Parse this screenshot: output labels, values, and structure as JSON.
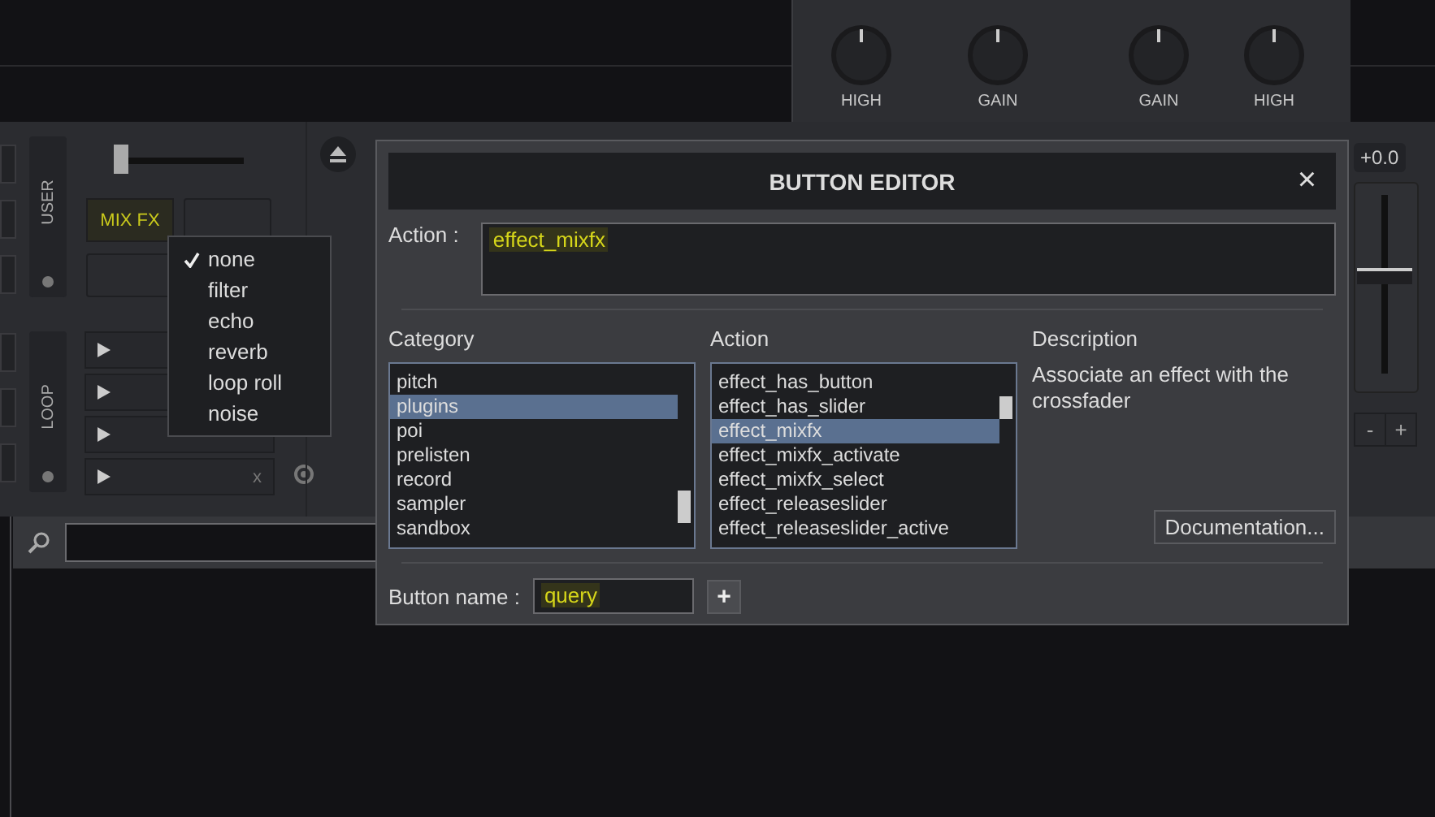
{
  "mixer": {
    "knobs": [
      {
        "label": "HIGH"
      },
      {
        "label": "GAIN"
      },
      {
        "label": "GAIN"
      },
      {
        "label": "HIGH"
      }
    ]
  },
  "deck": {
    "fader": {
      "level": 0.0
    },
    "user_label": "USER",
    "mixfx_button": "MIX FX",
    "loop_label": "LOOP",
    "loop_clear": "x"
  },
  "pitch": {
    "level": 0.5,
    "reading": "+0.0",
    "minus": "-",
    "plus": "+"
  },
  "fx_menu": {
    "items": [
      {
        "label": "none",
        "checked": true
      },
      {
        "label": "filter",
        "checked": false
      },
      {
        "label": "echo",
        "checked": false
      },
      {
        "label": "reverb",
        "checked": false
      },
      {
        "label": "loop roll",
        "checked": false
      },
      {
        "label": "noise",
        "checked": false
      }
    ]
  },
  "dialog": {
    "title": "BUTTON EDITOR",
    "close": "×",
    "action_label": "Action :",
    "action_value": "effect_mixfx",
    "category_heading": "Category",
    "action_heading": "Action",
    "description_heading": "Description",
    "categories": [
      {
        "label": "pitch",
        "selected": false
      },
      {
        "label": "plugins",
        "selected": true
      },
      {
        "label": "poi",
        "selected": false
      },
      {
        "label": "prelisten",
        "selected": false
      },
      {
        "label": "record",
        "selected": false
      },
      {
        "label": "sampler",
        "selected": false
      },
      {
        "label": "sandbox",
        "selected": false
      }
    ],
    "actions": [
      {
        "label": "effect_has_button",
        "selected": false
      },
      {
        "label": "effect_has_slider",
        "selected": false
      },
      {
        "label": "effect_mixfx",
        "selected": true
      },
      {
        "label": "effect_mixfx_activate",
        "selected": false
      },
      {
        "label": "effect_mixfx_select",
        "selected": false
      },
      {
        "label": "effect_releaseslider",
        "selected": false
      },
      {
        "label": "effect_releaseslider_active",
        "selected": false
      }
    ],
    "description": "Associate an effect with the crossfader",
    "documentation_button": "Documentation...",
    "button_name_label": "Button name :",
    "button_name_value": "query",
    "add_button": "+"
  }
}
